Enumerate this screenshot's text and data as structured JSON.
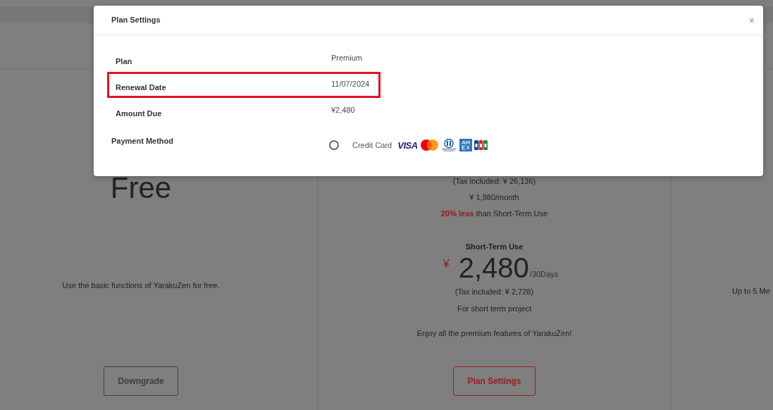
{
  "page": {
    "plans": [
      {
        "kind": "free",
        "price": "Free",
        "description": "Use the basic functions of YarakuZen for free.",
        "button": {
          "label": "Downgrade"
        }
      },
      {
        "kind": "premium",
        "annual_tax_note": "(Tax included: ¥ 26,136)",
        "monthly_price": "¥ 1,980/month",
        "discount_note": "**20% less** than Short-Term Use",
        "short_term": {
          "title": "Short-Term Use",
          "currency": "¥",
          "amount": "2,480",
          "period": "/30Days",
          "tax_note": "(Tax included: ¥ 2,728)",
          "note": "For short term project"
        },
        "description": "Enjoy all the premium features of YarakuZen!",
        "button": {
          "label": "Plan Settings"
        }
      },
      {
        "kind": "cut_off",
        "description": "Up to 5 Me"
      }
    ]
  },
  "modal": {
    "title": "Plan Settings",
    "close": "×",
    "rows": [
      {
        "label": "Plan",
        "value": "Premium",
        "highlighted": false
      },
      {
        "label": "Renewal Date",
        "value": "11/07/2024",
        "highlighted": true
      },
      {
        "label": "Amount Due",
        "value": "¥2,480",
        "highlighted": false
      }
    ],
    "payment": {
      "label": "Payment Method",
      "options": [
        {
          "label": "Credit Card",
          "selected": false,
          "logo_text": "VISA"
        }
      ]
    }
  }
}
